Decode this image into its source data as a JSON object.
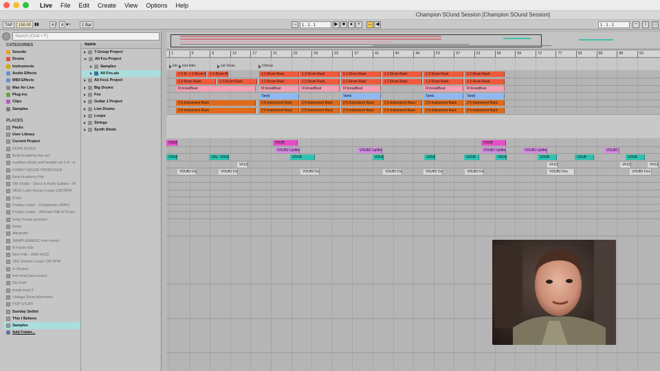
{
  "menubar": {
    "app": "Live",
    "items": [
      "File",
      "Edit",
      "Create",
      "View",
      "Options",
      "Help"
    ],
    "window_title": "Champion SOund Session  [Champion SOund Session]"
  },
  "control": {
    "tap": "TAP",
    "tempo": "150.00",
    "signature_num": "4",
    "signature_den": "4",
    "quantize": "1 Bar",
    "position": "1 .   1 .   1",
    "loop_end": "1 .   1 .   1"
  },
  "browser": {
    "search_placeholder": "Search (Cmd + F)",
    "categories_label": "CATEGORIES",
    "categories": [
      "Sounds",
      "Drums",
      "Instruments",
      "Audio Effects",
      "MIDI Effects",
      "Max for Live",
      "Plug-ins",
      "Clips",
      "Samples"
    ],
    "places_label": "PLACES",
    "places": [
      {
        "label": "Packs",
        "style": "bold"
      },
      {
        "label": "User Library",
        "style": "bold"
      },
      {
        "label": "Current Project",
        "style": "bold"
      },
      {
        "label": "DOPE KICKS",
        "style": "grey"
      },
      {
        "label": "Beat Academy live set",
        "style": "grey"
      },
      {
        "label": "scarface beats and breaks vol 1-4 - w",
        "style": "grey"
      },
      {
        "label": "FUNKY HOUSE PRODUCER",
        "style": "grey"
      },
      {
        "label": "Beat Academy Kits",
        "style": "grey"
      },
      {
        "label": "SM Studio - Disco & Funk Guitars - W",
        "style": "grey"
      },
      {
        "label": "VEH1 Latin House Loops 128 BPM",
        "style": "grey"
      },
      {
        "label": "ill kitz",
        "style": "grey"
      },
      {
        "label": "Freaky Loops - Complextro (WAV)",
        "style": "grey"
      },
      {
        "label": "Freaky Loops - Ultimate Fills & Drops",
        "style": "grey"
      },
      {
        "label": "funky house grooves",
        "style": "grey"
      },
      {
        "label": "loops",
        "style": "grey"
      },
      {
        "label": "dttransfer",
        "style": "grey"
      },
      {
        "label": "SAMPLEMAGIC from robert",
        "style": "grey"
      },
      {
        "label": "ill Factor bits",
        "style": "grey"
      },
      {
        "label": "Neo Folk - WAV-ACID",
        "style": "grey"
      },
      {
        "label": "VEE Electro Loops 128 BPM",
        "style": "grey"
      },
      {
        "label": "G Strums",
        "style": "grey"
      },
      {
        "label": "tool shed percussion",
        "style": "grey"
      },
      {
        "label": "Da Grail",
        "style": "grey"
      },
      {
        "label": "break beat 2",
        "style": "grey"
      },
      {
        "label": "Vintage Drum Machines",
        "style": "grey"
      },
      {
        "label": "POP STUFF",
        "style": "grey"
      },
      {
        "label": "Sunday Setlist",
        "style": "bold"
      },
      {
        "label": "This I Believe",
        "style": "bold"
      },
      {
        "label": "Samples",
        "style": "sel"
      },
      {
        "label": "Add Folder...",
        "style": "add"
      }
    ],
    "name_header": "Name",
    "files": [
      {
        "label": "7-Group Project",
        "depth": 0,
        "open": false
      },
      {
        "label": "All Fxs Project",
        "depth": 0,
        "open": true
      },
      {
        "label": "Samples",
        "depth": 1,
        "open": false
      },
      {
        "label": "All Fxs.als",
        "depth": 1,
        "open": false,
        "selected": true
      },
      {
        "label": "All Fxs1 Project",
        "depth": 0,
        "open": false
      },
      {
        "label": "Big Drums",
        "depth": 0,
        "open": false
      },
      {
        "label": "Fxs",
        "depth": 0,
        "open": false
      },
      {
        "label": "Guitar 1 Project",
        "depth": 0,
        "open": false
      },
      {
        "label": "Live Drums",
        "depth": 0,
        "open": false
      },
      {
        "label": "Loops",
        "depth": 0,
        "open": false
      },
      {
        "label": "Strings",
        "depth": 0,
        "open": false
      },
      {
        "label": "Synth Shots",
        "depth": 0,
        "open": false
      }
    ]
  },
  "arrangement": {
    "ruler": [
      "1",
      "5",
      "9",
      "13",
      "17",
      "21",
      "25",
      "29",
      "33",
      "37",
      "41",
      "45",
      "49",
      "53",
      "57",
      "61",
      "65",
      "69",
      "73",
      "77",
      "81",
      "85",
      "89",
      "93"
    ],
    "locators": [
      "Intr",
      "Inst Intro",
      "1st Verse",
      "Chorus"
    ]
  },
  "colors": {
    "drum_rack": "#ef5a3c",
    "breakbeat": "#f5a0b4",
    "tamb": "#8fb8f2",
    "instrument_rack": "#e06a1a",
    "riser": "#e94cc7",
    "uplifter": "#d68be6",
    "vdub_teal": "#2fc2b0",
    "vfx": "#d9d9d9",
    "accent_selected": "#a8dede"
  }
}
